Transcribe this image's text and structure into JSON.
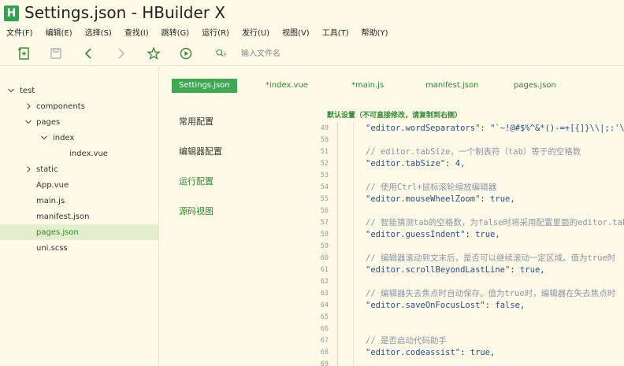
{
  "window": {
    "title": "Settings.json - HBuilder X",
    "logo_letter": "H"
  },
  "menu": [
    "文件(F)",
    "编辑(E)",
    "选择(S)",
    "查找(I)",
    "跳转(G)",
    "运行(R)",
    "发行(U)",
    "视图(V)",
    "工具(T)",
    "帮助(Y)"
  ],
  "toolbar": {
    "icons": [
      "new-file-icon",
      "save-icon",
      "back-icon",
      "forward-icon",
      "star-icon",
      "run-icon",
      "quick-open-icon"
    ],
    "quick_open_label": "F",
    "search_placeholder": "输入文件名"
  },
  "tree": {
    "items": [
      {
        "label": "test",
        "chevron": "down"
      },
      {
        "label": "components",
        "chevron": "right"
      },
      {
        "label": "pages",
        "chevron": "down"
      },
      {
        "label": "index",
        "chevron": "down"
      },
      {
        "label": "index.vue",
        "chevron": "none"
      },
      {
        "label": "static",
        "chevron": "right"
      },
      {
        "label": "App.vue",
        "chevron": "none"
      },
      {
        "label": "main.js",
        "chevron": "none"
      },
      {
        "label": "manifest.json",
        "chevron": "none"
      },
      {
        "label": "pages.json",
        "chevron": "none",
        "selected": true
      },
      {
        "label": "uni.scss",
        "chevron": "none"
      }
    ]
  },
  "tabs": [
    {
      "label": "Settings.json",
      "active": true
    },
    {
      "label": "*index.vue"
    },
    {
      "label": "*main.js"
    },
    {
      "label": "manifest.json"
    },
    {
      "label": "pages.json"
    }
  ],
  "settings_categories": [
    {
      "label": "常用配置"
    },
    {
      "label": "编辑器配置"
    },
    {
      "label": "运行配置"
    },
    {
      "label": "源码视图",
      "active": true
    }
  ],
  "editor": {
    "note": "默认设置（不可直接修改，请复制到右侧）",
    "lines": [
      {
        "n": "49",
        "key": "\"editor.wordSeparators\"",
        "value": "\"`~!@#$%^&*()-=+[{]}\\\\|;:'\\\",.<>/?\","
      },
      {
        "n": "50"
      },
      {
        "n": "51",
        "comment": "// editor.tabSize，一个制表符（tab）等于的空格数"
      },
      {
        "n": "52",
        "key": "\"editor.tabSize\"",
        "value": "4,"
      },
      {
        "n": "53"
      },
      {
        "n": "54",
        "comment": "// 使用Ctrl+鼠标滚轮缩放编辑器"
      },
      {
        "n": "55",
        "key": "\"editor.mouseWheelZoom\"",
        "value": "true,"
      },
      {
        "n": "56"
      },
      {
        "n": "57",
        "comment": "// 智能猜测tab的空格数，为false时将采用配置里面的editor.tabSize"
      },
      {
        "n": "58",
        "key": "\"editor.guessIndent\"",
        "value": "true,"
      },
      {
        "n": "59"
      },
      {
        "n": "60",
        "comment": "// 编辑器滚动到文末后，是否可以继续滚动一定区域。值为true时"
      },
      {
        "n": "61",
        "key": "\"editor.scrollBeyondLastLine\"",
        "value": "true,"
      },
      {
        "n": "62"
      },
      {
        "n": "63",
        "comment": "// 编辑器失去焦点时自动保存。值为true时，编辑器在失去焦点时"
      },
      {
        "n": "64",
        "key": "\"editor.saveOnFocusLost\"",
        "value": "false,"
      },
      {
        "n": "65"
      },
      {
        "n": "66"
      },
      {
        "n": "67",
        "comment": "// 是否启动代码助手"
      },
      {
        "n": "68",
        "key": "\"editor.codeassist\"",
        "value": "true,"
      },
      {
        "n": "69"
      }
    ]
  }
}
